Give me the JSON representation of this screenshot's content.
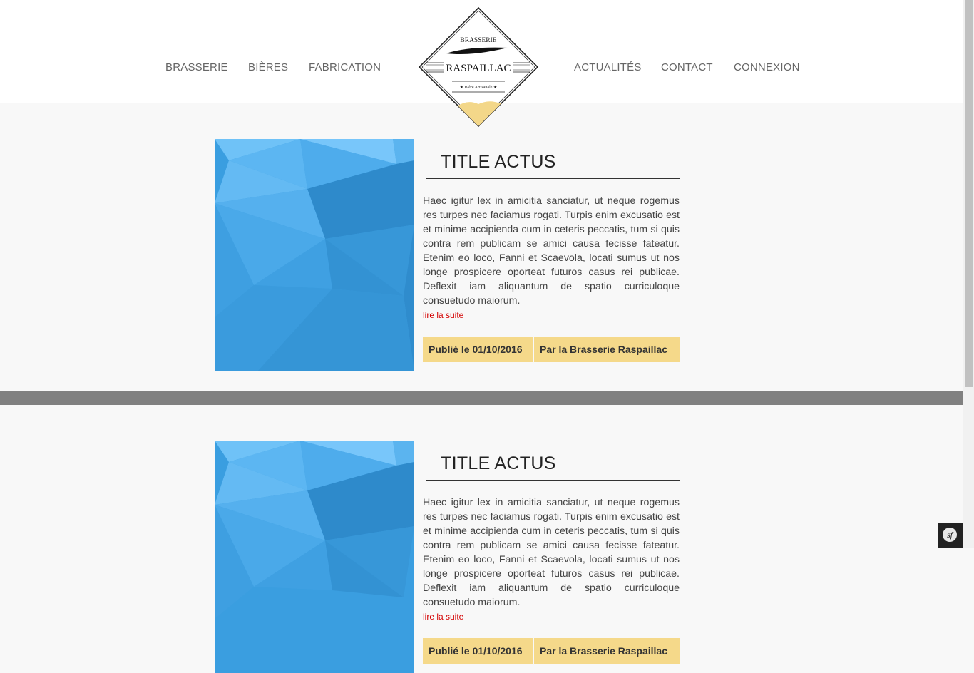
{
  "nav": {
    "left": [
      "BRASSERIE",
      "BIÈRES",
      "FABRICATION"
    ],
    "right": [
      "ACTUALITÉS",
      "CONTACT",
      "CONNEXION"
    ]
  },
  "logo": {
    "top_text": "BRASSERIE",
    "name": "RASPAILLAC",
    "tagline": "★ Bière Artisanale ★"
  },
  "articles": [
    {
      "title": "TITLE ACTUS",
      "body": "Haec igitur lex in amicitia sanciatur, ut neque rogemus res turpes nec faciamus rogati. Turpis enim excusatio est et minime accipienda cum in ceteris peccatis, tum si quis contra rem publicam se amici causa fecisse fateatur. Etenim eo loco, Fanni et Scaevola, locati sumus ut nos longe prospicere oporteat futuros casus rei publicae. Deflexit iam aliquantum de spatio curriculoque consuetudo maiorum.",
      "read_more": "lire la suite",
      "published": "Publié le 01/10/2016",
      "author": "Par la Brasserie Raspaillac"
    },
    {
      "title": "TITLE ACTUS",
      "body": "Haec igitur lex in amicitia sanciatur, ut neque rogemus res turpes nec faciamus rogati. Turpis enim excusatio est et minime accipienda cum in ceteris peccatis, tum si quis contra rem publicam se amici causa fecisse fateatur. Etenim eo loco, Fanni et Scaevola, locati sumus ut nos longe prospicere oporteat futuros casus rei publicae. Deflexit iam aliquantum de spatio curriculoque consuetudo maiorum.",
      "read_more": "lire la suite",
      "published": "Publié le 01/10/2016",
      "author": "Par la Brasserie Raspaillac"
    }
  ],
  "toolbar": {
    "icon": "symfony-icon",
    "label": "sf"
  },
  "colors": {
    "accent": "#f5d98a",
    "link": "#d40000",
    "separator": "#808080",
    "background": "#f8f8f8"
  }
}
